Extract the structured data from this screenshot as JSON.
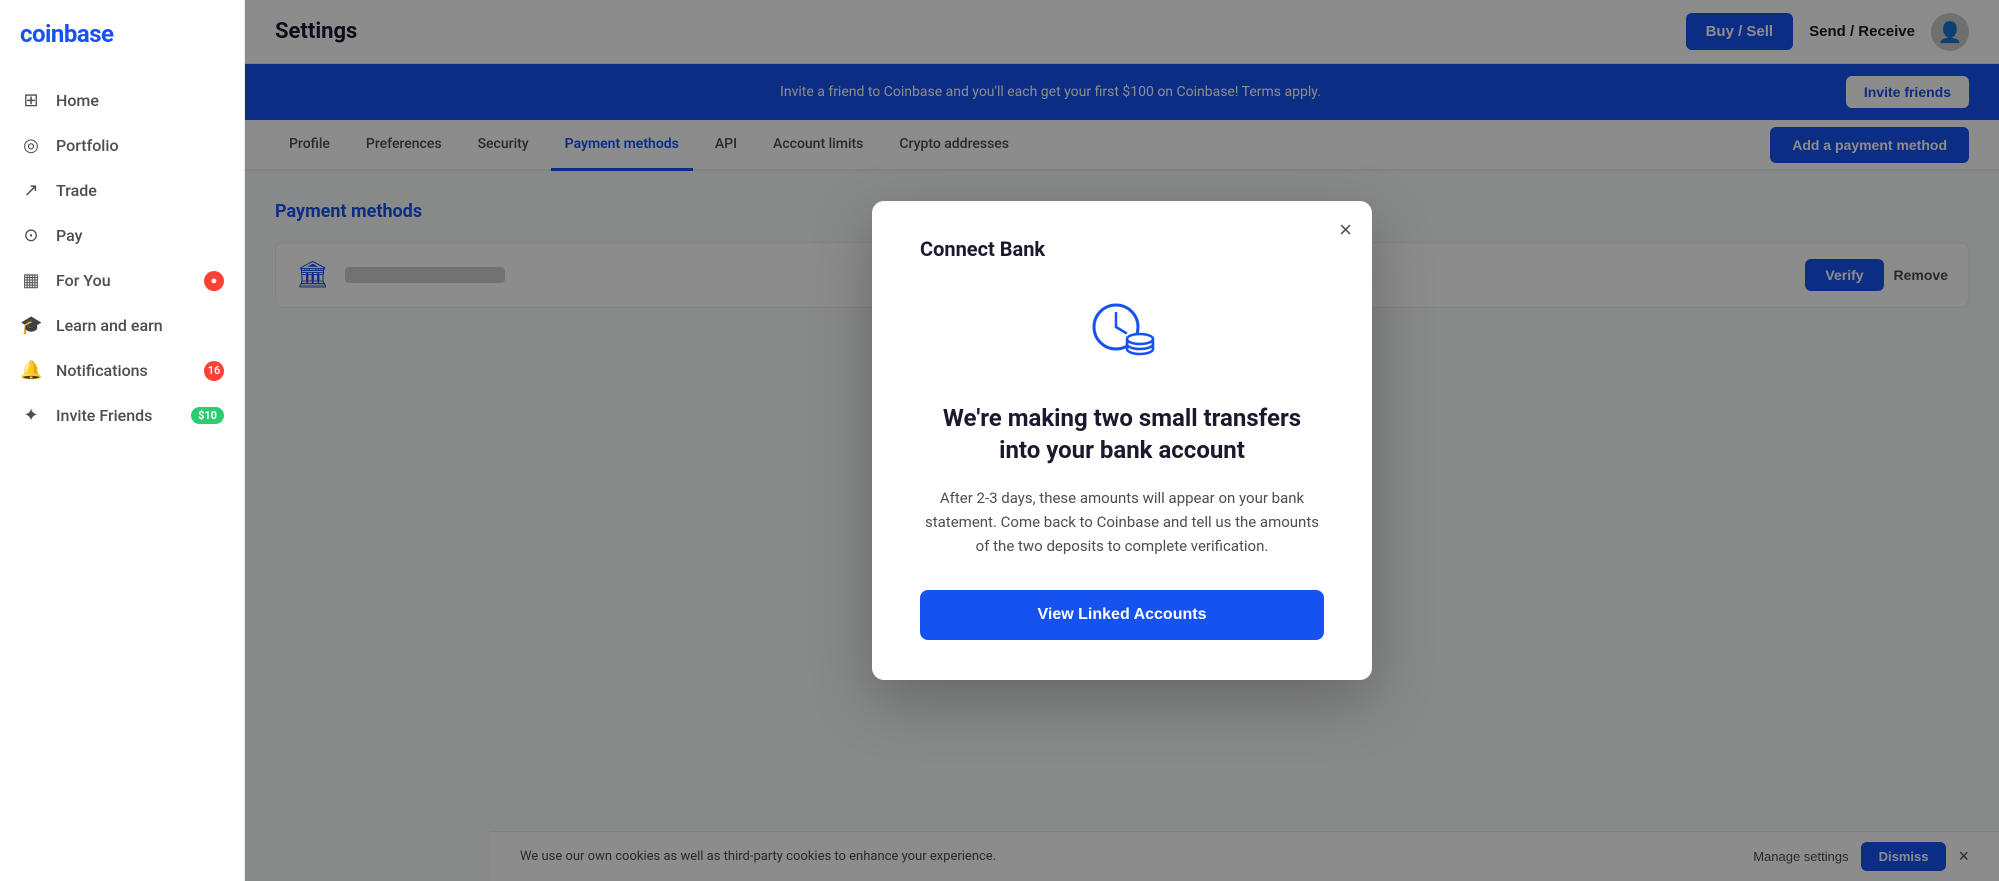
{
  "sidebar": {
    "logo": "coinbase",
    "items": [
      {
        "id": "home",
        "label": "Home",
        "icon": "⊞",
        "badge": null
      },
      {
        "id": "portfolio",
        "label": "Portfolio",
        "icon": "◎",
        "badge": null
      },
      {
        "id": "trade",
        "label": "Trade",
        "icon": "↗",
        "badge": null
      },
      {
        "id": "pay",
        "label": "Pay",
        "icon": "⊙",
        "badge": null
      },
      {
        "id": "for-you",
        "label": "For You",
        "icon": "▦",
        "badge": "red"
      },
      {
        "id": "learn-and-earn",
        "label": "Learn and earn",
        "icon": "🎓",
        "badge": null
      },
      {
        "id": "notifications",
        "label": "Notifications",
        "icon": "🔔",
        "badge": "16"
      },
      {
        "id": "invite-friends",
        "label": "Invite Friends",
        "icon": "✦",
        "badge_dollar": "$10"
      }
    ]
  },
  "header": {
    "title": "Settings",
    "buy_sell_label": "Buy / Sell",
    "send_receive_label": "Send / Receive"
  },
  "promo_banner": {
    "text": "Invite a friend to Coinbase and you'll each get your first $100 on Coinbase! Terms apply.",
    "invite_label": "Invite friends"
  },
  "settings_tabs": {
    "tabs": [
      {
        "id": "profile",
        "label": "Profile",
        "active": false
      },
      {
        "id": "preferences",
        "label": "Preferences",
        "active": false
      },
      {
        "id": "security",
        "label": "Security",
        "active": false
      },
      {
        "id": "payment-methods",
        "label": "Payment methods",
        "active": true
      },
      {
        "id": "api",
        "label": "API",
        "active": false
      },
      {
        "id": "account-limits",
        "label": "Account limits",
        "active": false
      },
      {
        "id": "crypto-addresses",
        "label": "Crypto addresses",
        "active": false
      }
    ],
    "add_payment_label": "Add a payment method"
  },
  "payment_methods": {
    "title": "Payment methods",
    "bank_icon": "🏛",
    "verify_label": "Verify",
    "remove_label": "Remove"
  },
  "modal": {
    "title": "Connect Bank",
    "close_icon": "×",
    "heading": "We're making two small transfers into your bank account",
    "description": "After 2-3 days, these amounts will appear on your bank statement. Come back to Coinbase and tell us the amounts of the two deposits to complete verification.",
    "cta_label": "View Linked Accounts"
  },
  "cookie_bar": {
    "text": "We use our own cookies as well as third-party cookies to enhance your experience.",
    "manage_label": "Manage settings",
    "dismiss_label": "Dismiss"
  }
}
